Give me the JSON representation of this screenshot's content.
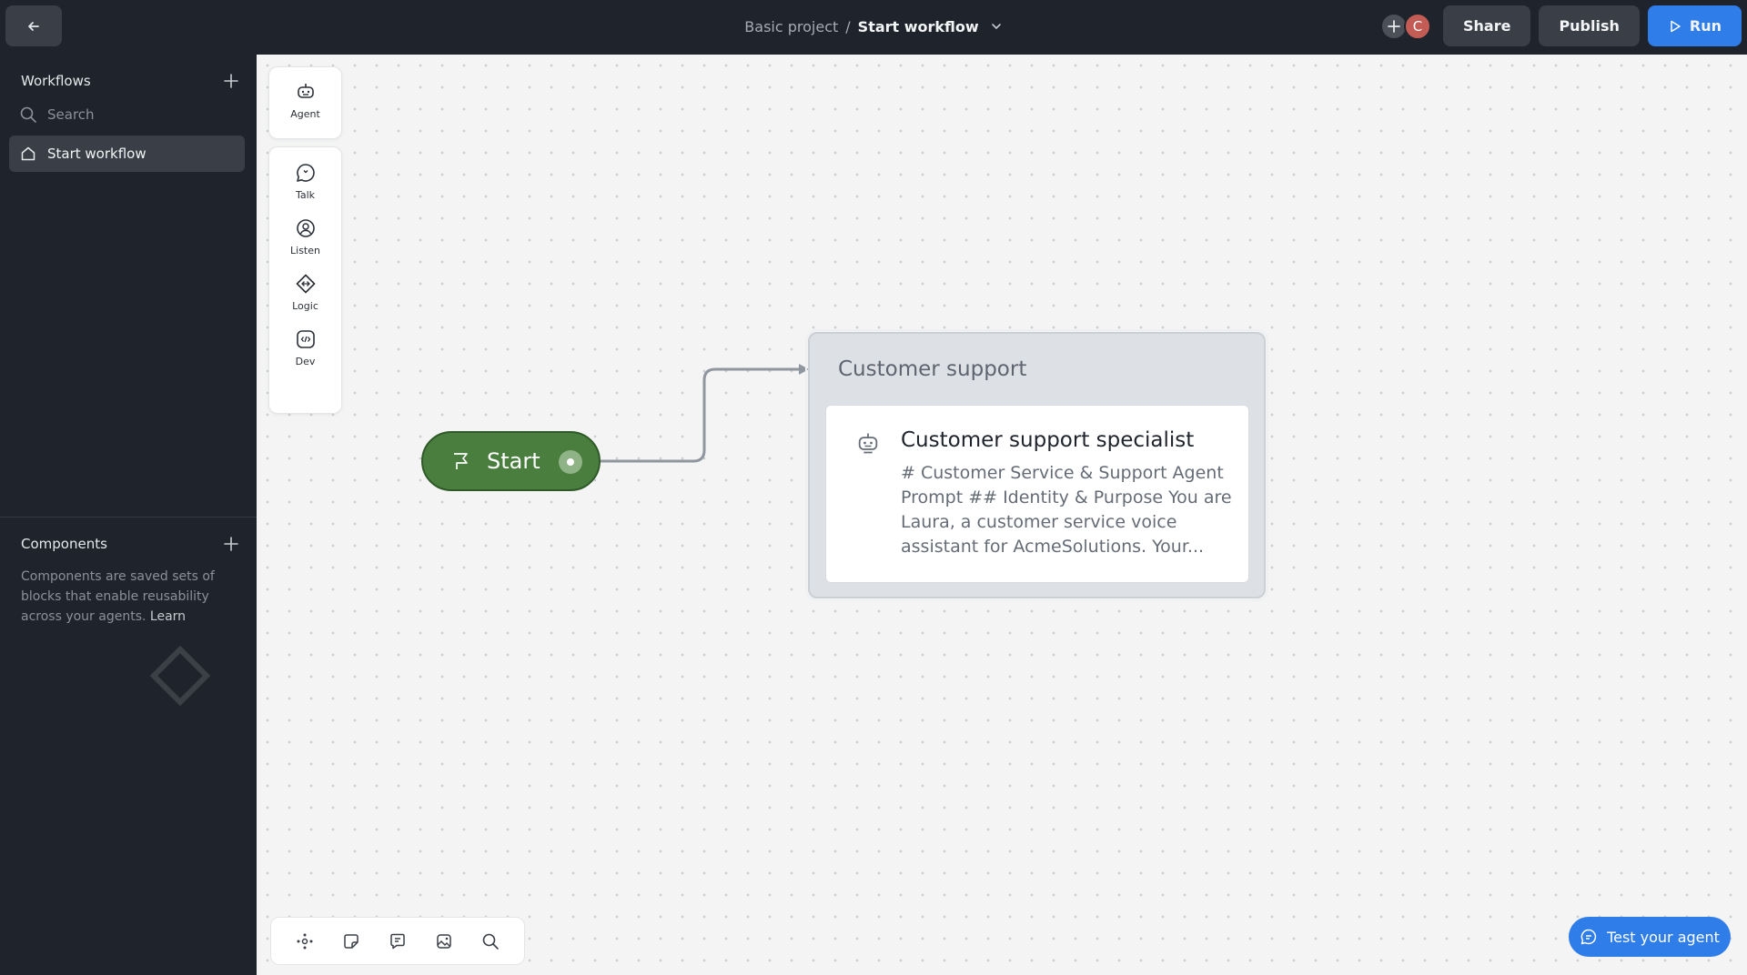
{
  "header": {
    "breadcrumb_project": "Basic project",
    "breadcrumb_separator": "/",
    "breadcrumb_current": "Start workflow",
    "avatar_initial": "C",
    "share_label": "Share",
    "publish_label": "Publish",
    "run_label": "Run"
  },
  "sidebar": {
    "workflows_title": "Workflows",
    "search_placeholder": "Search",
    "workflow_items": [
      "Start workflow"
    ],
    "components_title": "Components",
    "components_desc": "Components are saved sets of blocks that enable reusability across your agents.",
    "learn_label": "Learn"
  },
  "palette": {
    "items": [
      "Agent",
      "Talk",
      "Listen",
      "Logic",
      "Dev"
    ]
  },
  "canvas": {
    "start_label": "Start",
    "group_title": "Customer support",
    "card_title": "Customer support specialist",
    "card_text": "# Customer Service & Support Agent Prompt ## Identity & Purpose You are Laura, a customer service voice assistant for AcmeSolutions. Your..."
  },
  "footer": {
    "test_label": "Test your agent"
  },
  "colors": {
    "topbar_bg": "#1f242c",
    "accent_blue": "#2f7de9",
    "start_green": "#4a7e3f"
  }
}
